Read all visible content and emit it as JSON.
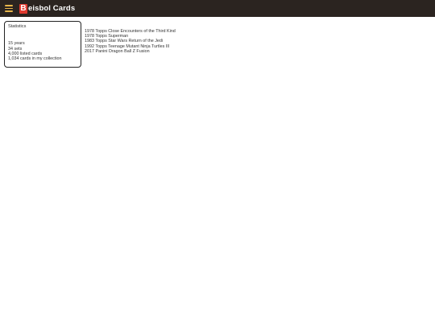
{
  "header": {
    "logo_letter": "B",
    "title": "eisbol Cards",
    "background": "#2b2420",
    "menu_icon_color": "#e8b64a",
    "logo_color": "#e03a2f"
  },
  "statistics": {
    "title": "Statistics",
    "lines": [
      "15 years",
      "34 sets",
      "4,000 listed cards",
      "1,034 cards in my collection"
    ]
  },
  "sets": [
    "1978 Topps Close Encounters of the Third Kind",
    "1978 Topps Superman",
    "1983 Topps Star Wars Return of the Jedi",
    "1992 Topps Teenage Mutant Ninja Turtles III",
    "2017 Panini Dragon Ball Z Fusion"
  ]
}
